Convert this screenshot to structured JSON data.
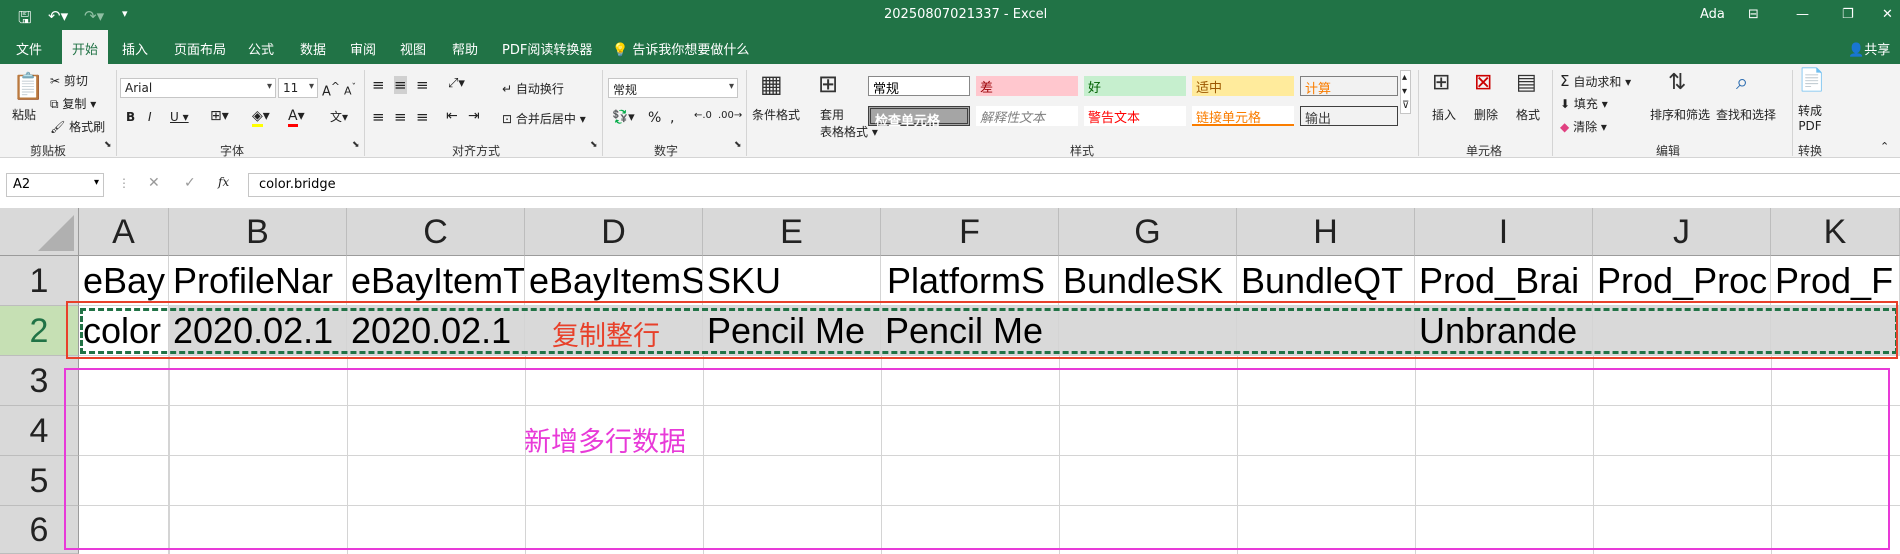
{
  "title_bar": {
    "filename": "20250807021337",
    "separator": " - ",
    "app": "Excel",
    "user": "Ada"
  },
  "tabs": [
    "文件",
    "开始",
    "插入",
    "页面布局",
    "公式",
    "数据",
    "审阅",
    "视图",
    "帮助",
    "PDF阅读转换器"
  ],
  "tell_me": "告诉我你想要做什么",
  "share": "共享",
  "ribbon": {
    "clipboard": {
      "paste": "粘贴",
      "cut": "剪切",
      "copy": "复制",
      "format_painter": "格式刷",
      "label": "剪贴板"
    },
    "font": {
      "name": "Arial",
      "size": "11",
      "label": "字体"
    },
    "alignment": {
      "wrap": "自动换行",
      "merge": "合并后居中",
      "label": "对齐方式"
    },
    "number": {
      "format": "常规",
      "label": "数字"
    },
    "styles": {
      "conditional": "条件格式",
      "table_format_1": "套用",
      "table_format_2": "表格格式",
      "label": "样式",
      "cells": [
        {
          "text": "常规",
          "bg": "#ffffff",
          "color": "#000000"
        },
        {
          "text": "差",
          "bg": "#ffc7ce",
          "color": "#9c0006"
        },
        {
          "text": "好",
          "bg": "#c6efce",
          "color": "#006100"
        },
        {
          "text": "适中",
          "bg": "#ffeb9c",
          "color": "#9c5700"
        },
        {
          "text": "计算",
          "bg": "#f2f2f2",
          "color": "#fa7d00"
        },
        {
          "text": "检查单元格",
          "bg": "#a5a5a5",
          "color": "#ffffff"
        },
        {
          "text": "解释性文本",
          "bg": "#ffffff",
          "color": "#7f7f7f"
        },
        {
          "text": "警告文本",
          "bg": "#ffffff",
          "color": "#ff0000"
        },
        {
          "text": "链接单元格",
          "bg": "#ffffff",
          "color": "#fa7d00"
        },
        {
          "text": "输出",
          "bg": "#f2f2f2",
          "color": "#3f3f3f"
        }
      ]
    },
    "cells_group": {
      "insert": "插入",
      "delete": "删除",
      "format": "格式",
      "label": "单元格"
    },
    "editing": {
      "autosum": "自动求和",
      "fill": "填充",
      "clear": "清除",
      "sort": "排序和筛选",
      "find": "查找和选择",
      "label": "编辑"
    },
    "convert": {
      "to_pdf_1": "转成",
      "to_pdf_2": "PDF",
      "label": "转换"
    }
  },
  "formula_bar": {
    "name_box": "A2",
    "fx": "fx",
    "formula": "color.bridge"
  },
  "columns": [
    "A",
    "B",
    "C",
    "D",
    "E",
    "F",
    "G",
    "H",
    "I",
    "J",
    "K"
  ],
  "rows": [
    "1",
    "2",
    "3",
    "4",
    "5",
    "6"
  ],
  "row1": [
    "eBay",
    "ProfileNar",
    "eBayItemT",
    "eBayItemS",
    "SKU",
    "PlatformS",
    "BundleSK",
    "BundleQT",
    "Prod_Brai",
    "Prod_Proc",
    "Prod_F"
  ],
  "row2": [
    "color",
    "2020.02.1",
    "2020.02.1",
    "",
    "Pencil Me",
    "Pencil Me",
    "",
    "",
    "Unbrande",
    "",
    ""
  ],
  "annotations": {
    "copy_row": "复制整行",
    "add_rows": "新增多行数据"
  }
}
